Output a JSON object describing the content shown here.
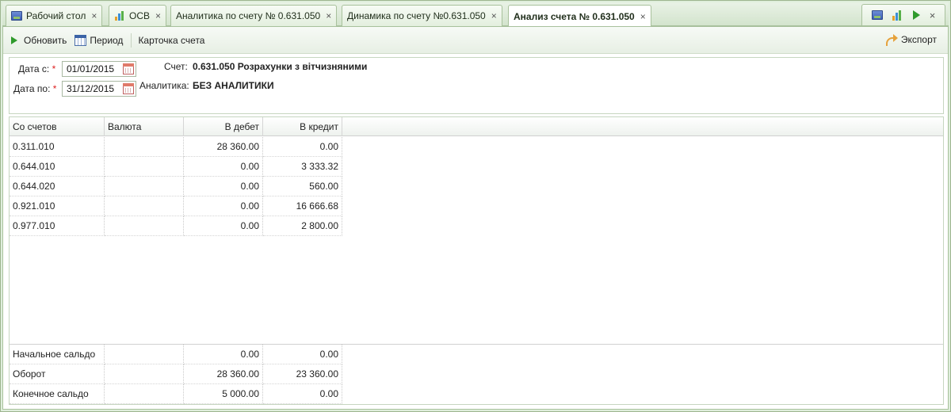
{
  "tabs": [
    {
      "label": "Рабочий стол",
      "icon": "desktop-icon",
      "active": false
    },
    {
      "label": "ОСВ",
      "icon": "bar-chart-icon",
      "active": false
    },
    {
      "label": "Аналитика по счету № 0.631.050",
      "icon": "",
      "active": false
    },
    {
      "label": "Динамика по счету №0.631.050",
      "icon": "",
      "active": false
    },
    {
      "label": "Анализ счета № 0.631.050",
      "icon": "",
      "active": true
    }
  ],
  "tab_close_glyph": "×",
  "right_tools": [
    "desktop-icon",
    "bar-chart-icon",
    "play-icon",
    "close-icon"
  ],
  "toolbar": {
    "refresh_label": "Обновить",
    "period_label": "Период",
    "card_label": "Карточка счета",
    "export_label": "Экспорт"
  },
  "filter": {
    "date_from_label": "Дата с:",
    "date_from_value": "01/01/2015",
    "date_to_label": "Дата по:",
    "date_to_value": "31/12/2015",
    "required_mark": "*",
    "account_label": "Счет:",
    "account_value": "0.631.050 Розрахунки з вітчизняними",
    "analytics_label": "Аналитика:",
    "analytics_value": "БЕЗ АНАЛИТИКИ"
  },
  "grid": {
    "columns": [
      "Со счетов",
      "Валюта",
      "В дебет",
      "В кредит"
    ],
    "rows": [
      [
        "0.311.010",
        "",
        "28 360.00",
        "0.00"
      ],
      [
        "0.644.010",
        "",
        "0.00",
        "3 333.32"
      ],
      [
        "0.644.020",
        "",
        "0.00",
        "560.00"
      ],
      [
        "0.921.010",
        "",
        "0.00",
        "16 666.68"
      ],
      [
        "0.977.010",
        "",
        "0.00",
        "2 800.00"
      ]
    ],
    "summary": [
      [
        "Начальное сальдо",
        "",
        "0.00",
        "0.00"
      ],
      [
        "Оборот",
        "",
        "28 360.00",
        "23 360.00"
      ],
      [
        "Конечное сальдо",
        "",
        "5 000.00",
        "0.00"
      ]
    ]
  },
  "colors": {
    "accent_green": "#2f9a2c",
    "frame_green": "#a8c19c",
    "required_red": "#dd2222"
  }
}
